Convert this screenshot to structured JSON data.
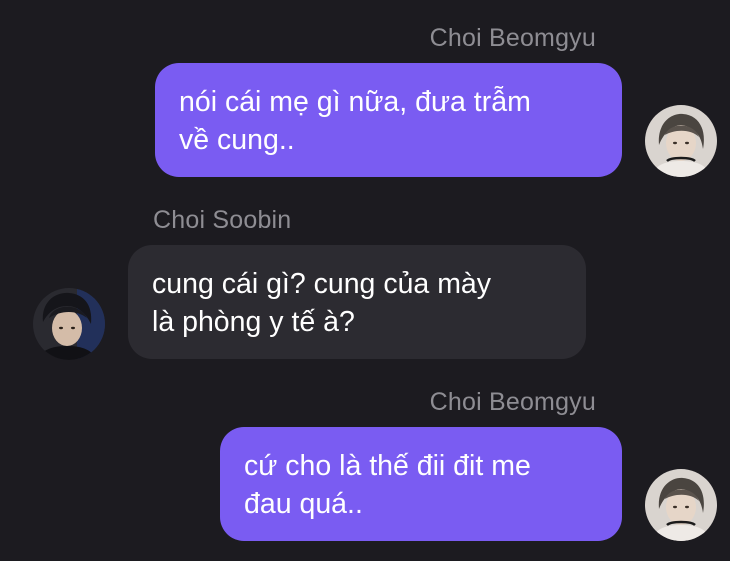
{
  "messages": [
    {
      "sender": "Choi Beomgyu",
      "direction": "outgoing",
      "text": "nói cái mẹ gì nữa, đưa trẫm\nvề cung..",
      "avatar": "beomgyu-avatar"
    },
    {
      "sender": "Choi Soobin",
      "direction": "incoming",
      "text": "cung cái gì? cung của mày\nlà phòng y tế à?",
      "avatar": "soobin-avatar"
    },
    {
      "sender": "Choi Beomgyu",
      "direction": "outgoing",
      "text": "cứ cho là thế đii đit me\nđau quá..",
      "avatar": "beomgyu-avatar"
    }
  ],
  "colors": {
    "background": "#1c1b20",
    "outgoing_bubble": "#7a5cf2",
    "incoming_bubble": "#2c2b31",
    "sender_name": "#8e8d93",
    "message_text": "#ffffff"
  }
}
